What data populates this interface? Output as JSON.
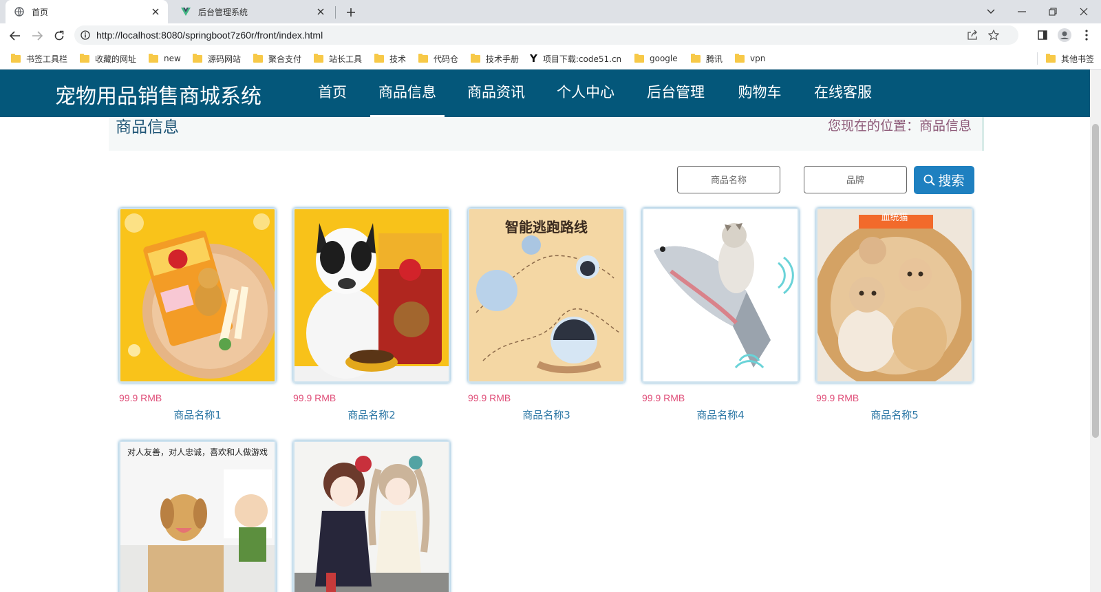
{
  "browser": {
    "tabs": [
      {
        "title": "首页",
        "active": true
      },
      {
        "title": "后台管理系统",
        "active": false
      }
    ],
    "url": "http://localhost:8080/springboot7z60r/front/index.html",
    "bookmarks": [
      "书签工具栏",
      "收藏的网址",
      "new",
      "源码网站",
      "聚合支付",
      "站长工具",
      "技术",
      "代码仓",
      "技术手册",
      "项目下载:code51.cn",
      "google",
      "腾讯",
      "vpn"
    ],
    "other_bookmarks": "其他书签"
  },
  "site": {
    "title": "宠物用品销售商城系统",
    "nav": [
      "首页",
      "商品信息",
      "商品资讯",
      "个人中心",
      "后台管理",
      "购物车",
      "在线客服"
    ],
    "active_nav": "商品信息",
    "brand_color": "#04577a"
  },
  "breadcrumb": {
    "title": "商品信息",
    "location": "您现在的位置：商品信息"
  },
  "search": {
    "name_placeholder": "商品名称",
    "brand_placeholder": "品牌",
    "button_label": "搜索"
  },
  "products": [
    {
      "price": "99.9 RMB",
      "name": "商品名称1",
      "image": "pedigree-dog-treats"
    },
    {
      "price": "99.9 RMB",
      "name": "商品名称2",
      "image": "pedigree-dog-food-bulldog"
    },
    {
      "price": "99.9 RMB",
      "name": "商品名称3",
      "image": "smart-cat-ball-toy",
      "image_text": "智能逃跑路线"
    },
    {
      "price": "99.9 RMB",
      "name": "商品名称4",
      "image": "fish-toy-with-cat"
    },
    {
      "price": "99.9 RMB",
      "name": "商品名称5",
      "image": "kittens-in-basket",
      "image_text": "血统猫"
    },
    {
      "image": "puppy-and-child",
      "image_text": "对人友善，对人忠诚，喜欢和人做游戏"
    },
    {
      "image": "anime-girls"
    }
  ]
}
